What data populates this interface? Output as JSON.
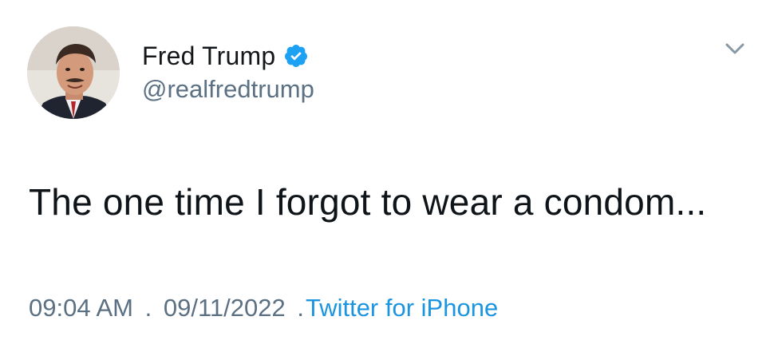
{
  "author": {
    "display_name": "Fred Trump",
    "handle": "@realfredtrump",
    "verified": true
  },
  "tweet": {
    "text": "The one time I forgot to wear a condom..."
  },
  "meta": {
    "time": "09:04 AM",
    "separator_1": ".",
    "date": "09/11/2022",
    "separator_2": ".",
    "source": "Twitter for iPhone"
  },
  "colors": {
    "text_primary": "#0f1419",
    "text_secondary": "#5b7083",
    "link": "#1b95e0",
    "verified_badge": "#1da1f2"
  },
  "icons": {
    "verified": "verified-badge-icon",
    "menu": "chevron-down-icon"
  }
}
